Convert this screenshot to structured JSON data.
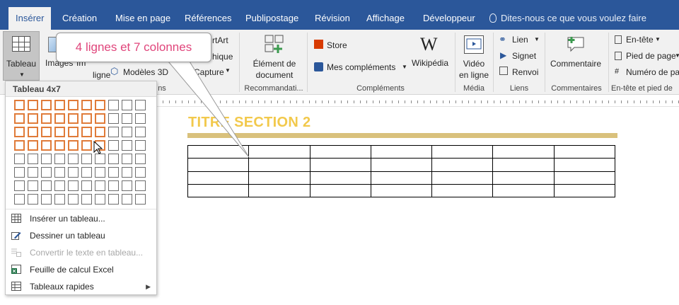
{
  "tabs": [
    {
      "label": "Insérer",
      "active": true
    },
    {
      "label": "Création"
    },
    {
      "label": "Mise en page"
    },
    {
      "label": "Références"
    },
    {
      "label": "Publipostage"
    },
    {
      "label": "Révision"
    },
    {
      "label": "Affichage"
    },
    {
      "label": "Développeur"
    }
  ],
  "tell_me": "Dites-nous ce que vous voulez faire",
  "ribbon": {
    "tableau_label": "Tableau",
    "images_label": "Images",
    "images_suffix": "Im",
    "online_suffix": "ligne",
    "modeles_3d": "Modèles 3D",
    "smartart": "rtArt",
    "graphique": "hique",
    "capture": "Capture",
    "element_document": [
      "Élément de",
      "document"
    ],
    "store": "Store",
    "mes_complements": "Mes compléments",
    "wikipedia": "Wikipédia",
    "video": [
      "Vidéo",
      "en ligne"
    ],
    "lien": "Lien",
    "signet": "Signet",
    "renvoi": "Renvoi",
    "commentaire": "Commentaire",
    "en_tete": "En-tête",
    "pied_de_page": "Pied de page",
    "numero_de_page": "Numéro de pa",
    "groups": {
      "illustrations_tail": "ns",
      "recommandation": "Recommandati...",
      "complements": "Compléments",
      "media": "Média",
      "liens": "Liens",
      "commentaires": "Commentaires",
      "entete_pied": "En-tête et pied de"
    }
  },
  "dropdown": {
    "header": "Tableau 4x7",
    "grid_rows": 8,
    "grid_cols": 10,
    "selected_rows": 4,
    "selected_cols": 7,
    "items": [
      {
        "label": "Insérer un tableau...",
        "icon": "insert-table-icon"
      },
      {
        "label": "Dessiner un tableau",
        "icon": "draw-table-icon"
      },
      {
        "label": "Convertir le texte en tableau...",
        "icon": "convert-text-icon",
        "disabled": true
      },
      {
        "label": "Feuille de calcul Excel",
        "icon": "excel-icon"
      },
      {
        "label": "Tableaux rapides",
        "icon": "quick-tables-icon",
        "submenu": true
      }
    ]
  },
  "callout": "4 lignes et 7 colonnes",
  "document": {
    "title": "TITRE SECTION 2",
    "table_rows": 4,
    "table_cols": 7
  },
  "colors": {
    "ribbon_blue": "#2b579a",
    "highlight_orange": "#e07b39",
    "title_gold": "#f2c94c",
    "callout_pink": "#e0457b"
  }
}
